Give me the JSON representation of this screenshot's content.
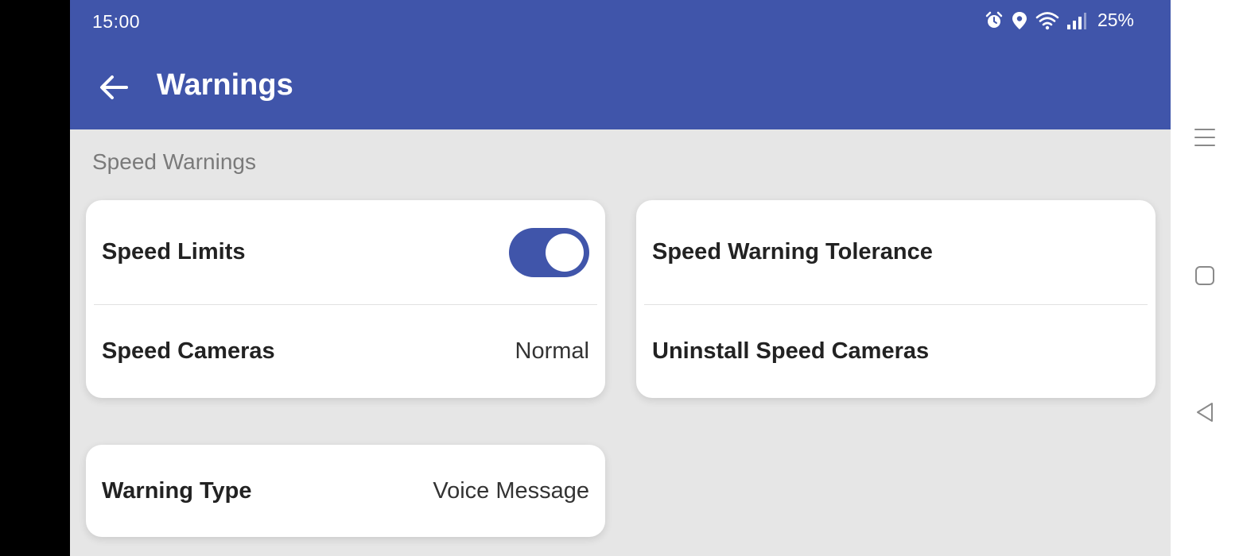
{
  "status_bar": {
    "time": "15:00",
    "battery": "25%",
    "icons": [
      "alarm-icon",
      "location-icon",
      "wifi-icon",
      "signal-icon"
    ]
  },
  "app_bar": {
    "title": "Warnings",
    "back_icon": "arrow-left-icon",
    "color": "#4055aa"
  },
  "section": {
    "header": "Speed Warnings"
  },
  "cards": {
    "left": {
      "speed_limits": {
        "label": "Speed Limits",
        "toggle_on": true
      },
      "speed_cameras": {
        "label": "Speed Cameras",
        "value": "Normal"
      }
    },
    "right": {
      "tolerance": {
        "label": "Speed Warning Tolerance"
      },
      "uninstall": {
        "label": "Uninstall Speed Cameras"
      }
    },
    "warning_type": {
      "label": "Warning Type",
      "value": "Voice Message"
    }
  },
  "nav_bar": {
    "icons": [
      "menu-icon",
      "home-square-icon",
      "back-triangle-icon"
    ]
  }
}
